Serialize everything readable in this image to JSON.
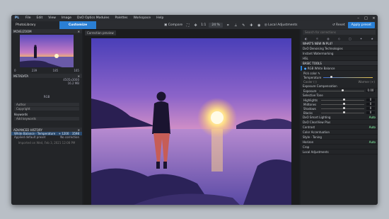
{
  "menu": {
    "logo": "PL",
    "items": [
      "File",
      "Edit",
      "View",
      "Image",
      "DxO Optics Modules",
      "Palettes",
      "Workspace",
      "Help"
    ]
  },
  "toolbar": {
    "photolibrary": "PhotoLibrary",
    "customize": "Customize",
    "compare": "Compare",
    "zoom_label": "1:1",
    "zoom_value": "24 %",
    "local_adjustments": "Local Adjustments",
    "reset": "Reset",
    "apply_preset": "Apply preset"
  },
  "left": {
    "move_zoom_title": "MOVE/ZOOM",
    "histo": {
      "a": "0",
      "b": "239",
      "c": "185",
      "d": "165"
    },
    "metadata_title": "METADATA",
    "meta": {
      "dims": "4505x3000",
      "size": "16.2 MB",
      "colorspace": "RGB"
    },
    "author_label": "Author",
    "copyright_label": "Copyright",
    "keywords_title": "Keywords",
    "keywords_placeholder": "Add keywords",
    "history_title": "ADVANCED HISTORY",
    "history": [
      {
        "label": "White Balance - Temperature",
        "value": "+ 1200",
        "extra": "3598",
        "selected": true
      },
      {
        "label": "Applied default preset",
        "value": "No correction",
        "selected": false
      }
    ],
    "imported": "Imported on Wed, Feb 3, 2021 12:08 PM"
  },
  "center": {
    "correction_preview": "Correction preview"
  },
  "right": {
    "search_placeholder": "Search for corrections",
    "whats_new": "WHAT'S NEW IN PL4?",
    "new_items": [
      "DxO Denoising Technologies",
      "Instant Watermarking",
      "HSL"
    ],
    "basic_tools": "BASIC TOOLS",
    "white_balance": "RGB White Balance",
    "pick_color": "Pick color",
    "temperature": "Temperature",
    "cooler": "Cooler (-)",
    "warmer": "Warmer (+)",
    "exposure_comp": "Exposure Compensation",
    "exposure": "Exposure",
    "exposure_val": "0.00",
    "selective_tone": "Selective Tone",
    "tones": [
      "Highlights",
      "Midtones",
      "Shadows",
      "Blacks"
    ],
    "tone_val": "0",
    "lower": [
      {
        "label": "DxO Smart Lighting",
        "auto": "Auto"
      },
      {
        "label": "DxO ClearView Plus",
        "auto": ""
      },
      {
        "label": "Contrast",
        "auto": "Auto"
      },
      {
        "label": "Color Accentuation",
        "auto": ""
      },
      {
        "label": "Style - Toning",
        "auto": ""
      },
      {
        "label": "Horizon",
        "auto": "Auto"
      },
      {
        "label": "Crop",
        "auto": ""
      },
      {
        "label": "Local Adjustments",
        "auto": ""
      }
    ]
  }
}
